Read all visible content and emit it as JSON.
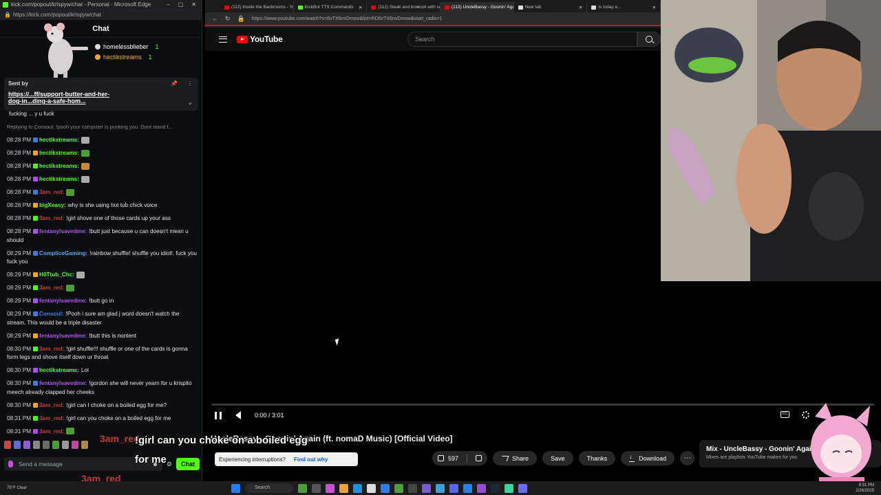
{
  "chat_window": {
    "title": "kick.com/popout/krispyw/chat - Personal - Microsoft Edge",
    "url": "https://kick.com/popout/krispyw/chat",
    "header": "Chat",
    "top_chatters": [
      {
        "name": "homelessblieber",
        "count": "1"
      },
      {
        "name": "hectikstreams",
        "count": "1"
      }
    ],
    "pinned": {
      "label": "Sent by",
      "link_line1": "https://...ff/support-butter-and-her-",
      "link_line2": "dog-in...ding-a-safe-hom..."
    },
    "messages": [
      {
        "time": "",
        "user": "",
        "user_color": "#e8e8e8",
        "text": "fucking ... y u fuck",
        "reply": ""
      },
      {
        "time": "",
        "user": "",
        "user_color": "#e8e8e8",
        "text": "",
        "reply": "Replying to Consoul: !pooh your computer is punking you. Dont stand f..."
      },
      {
        "time": "08:28 PM",
        "user": "hectikstreams:",
        "user_color": "#53fc18",
        "text": "",
        "reply": ""
      },
      {
        "time": "08:28 PM",
        "user": "hectikstreams:",
        "user_color": "#53fc18",
        "text": "",
        "reply": ""
      },
      {
        "time": "08:28 PM",
        "user": "hectikstreams:",
        "user_color": "#53fc18",
        "text": "",
        "reply": ""
      },
      {
        "time": "08:28 PM",
        "user": "hectikstreams:",
        "user_color": "#53fc18",
        "text": "",
        "reply": ""
      },
      {
        "time": "08:28 PM",
        "user": "3am_red:",
        "user_color": "#c43a3a",
        "text": "",
        "reply": ""
      },
      {
        "time": "08:28 PM",
        "user": "bigXeasy:",
        "user_color": "#53fc18",
        "text": "why is she using hot tub chick voice",
        "reply": ""
      },
      {
        "time": "08:28 PM",
        "user": "3am_red:",
        "user_color": "#c43a3a",
        "text": "!girl shove one of those cards up your ass",
        "reply": ""
      },
      {
        "time": "08:28 PM",
        "user": "fentanylsavedme:",
        "user_color": "#b04cf0",
        "text": "!butt just because u can doesn't mean u should",
        "reply": ""
      },
      {
        "time": "08:29 PM",
        "user": "ComplicеGaming:",
        "user_color": "#59a7f5",
        "text": "!rainbow shuffle! shuffle you idiot!. fuck you fuck you",
        "reply": ""
      },
      {
        "time": "08:29 PM",
        "user": "H0Ttub_Chc:",
        "user_color": "#53fc18",
        "text": "",
        "reply": ""
      },
      {
        "time": "08:29 PM",
        "user": "3am_red:",
        "user_color": "#c43a3a",
        "text": "",
        "reply": ""
      },
      {
        "time": "08:29 PM",
        "user": "fentanylsavedme:",
        "user_color": "#b04cf0",
        "text": "!butt go in",
        "reply": ""
      },
      {
        "time": "08:29 PM",
        "user": "Consoul:",
        "user_color": "#3d7bd9",
        "text": "!Pooh i sure am glad j word doesn't watch the stream. This would be a triple disaster",
        "reply": ""
      },
      {
        "time": "08:29 PM",
        "user": "fentanylsavedme:",
        "user_color": "#b04cf0",
        "text": "!butt this is nontent",
        "reply": ""
      },
      {
        "time": "08:30 PM",
        "user": "3am_red:",
        "user_color": "#c43a3a",
        "text": "!girl shuffle!!! shuffle or one of the cards is gonna form legs and shove itself down ur throat",
        "reply": ""
      },
      {
        "time": "08:30 PM",
        "user": "hectikstreams:",
        "user_color": "#53fc18",
        "text": "Lol",
        "reply": ""
      },
      {
        "time": "08:30 PM",
        "user": "fentanylsavedme:",
        "user_color": "#b04cf0",
        "text": "!gordon she will never yearn for u krispito meech already clapped her cheeks",
        "reply": ""
      },
      {
        "time": "08:30 PM",
        "user": "3am_red:",
        "user_color": "#c43a3a",
        "text": "!girl can I choke on a boiled egg for me?",
        "reply": ""
      },
      {
        "time": "08:31 PM",
        "user": "3am_red:",
        "user_color": "#c43a3a",
        "text": "!girl can you choke on a boiled egg for me",
        "reply": ""
      },
      {
        "time": "08:31 PM",
        "user": "3am_red:",
        "user_color": "#c43a3a",
        "text": "",
        "reply": ""
      }
    ],
    "input_placeholder": "Send a message",
    "send_label": "Chat"
  },
  "browser": {
    "tabs": [
      {
        "label": "(112) Inside the Backrooms - You...",
        "active": false,
        "icon": "youtube"
      },
      {
        "label": "KickBot TTS Commands",
        "active": false,
        "icon": "kick"
      },
      {
        "label": "(112) Steak and broccoli with som...",
        "active": false,
        "icon": "youtube"
      },
      {
        "label": "(112) UncleBassy - Goonin' Again...",
        "active": true,
        "icon": "youtube"
      },
      {
        "label": "New tab",
        "active": false,
        "icon": "newtab"
      },
      {
        "label": "is today e...",
        "active": false,
        "icon": "google"
      }
    ],
    "url": "https://www.youtube.com/watch?v=6vTX6nxDmxw&list=RD6vTX6nxDmxw&start_radio=1"
  },
  "youtube": {
    "logo_text": "YouTube",
    "search_placeholder": "Search",
    "time_display": "0:00 / 3:01",
    "progress_fraction": 0.0,
    "video_title": "UncleBassy - Goonin' Again (ft. nomaD Music) [Official Video]",
    "likes": "597",
    "share_label": "Share",
    "save_label": "Save",
    "thanks_label": "Thanks",
    "download_label": "Download",
    "toast_text": "Experiencing interruptions?",
    "toast_link": "Find out why",
    "mix_title": "Mix - UncleBassy - Goonin' Again",
    "mix_sub": "Mixes are playlists YouTube makes for you"
  },
  "overlay": {
    "tts_user": "3am_red",
    "tts_line1": "!girl can you choke on a boiled egg",
    "tts_line2": "for me"
  },
  "taskbar": {
    "weather": "75°F Clear",
    "search_label": "Search",
    "time": "8:31 PM",
    "date": "2/26/2025"
  },
  "colors": {
    "kick_green": "#53fc18",
    "youtube_red": "#ff0000",
    "edge_accent": "#c71b1b"
  }
}
